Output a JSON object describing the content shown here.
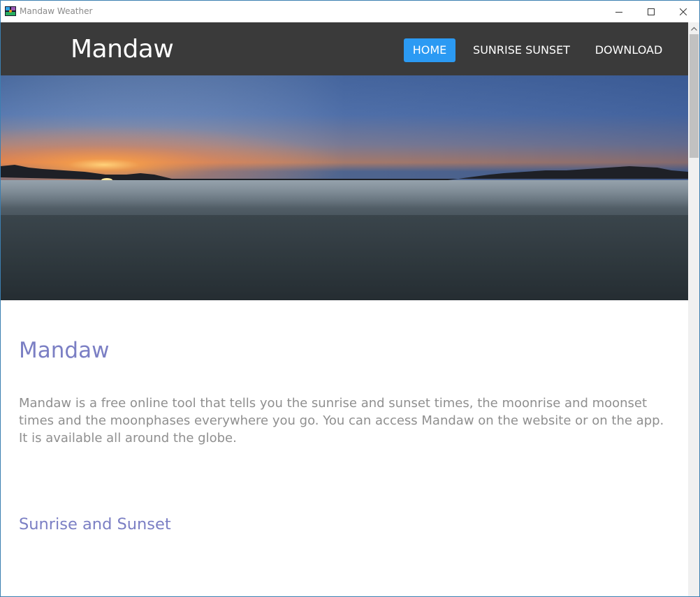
{
  "window": {
    "title": "Mandaw Weather"
  },
  "nav": {
    "brand": "Mandaw",
    "links": [
      {
        "label": "HOME",
        "active": true
      },
      {
        "label": "SUNRISE SUNSET",
        "active": false
      },
      {
        "label": "DOWNLOAD",
        "active": false
      }
    ]
  },
  "content": {
    "heading": "Mandaw",
    "intro": "Mandaw is a free online tool that tells you the sunrise and sunset times, the moonrise and moonset times and the moonphases everywhere you go. You can access Mandaw on the website or on the app. It is available all around the globe.",
    "section_heading": "Sunrise and Sunset"
  },
  "colors": {
    "navbar_bg": "#3a3a3a",
    "active_link": "#2b9af3",
    "heading": "#7b7fc4",
    "body_text": "#8f8f8f"
  },
  "icons": {
    "app": "weather-app-icon",
    "minimize": "minimize-icon",
    "maximize": "maximize-icon",
    "close": "close-icon",
    "scroll_up": "chevron-up-icon"
  }
}
